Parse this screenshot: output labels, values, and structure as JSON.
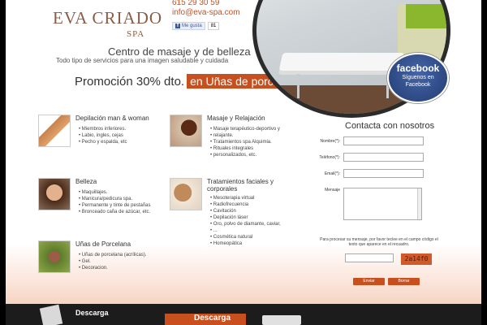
{
  "header": {
    "logo_main": "EVA CRIADO",
    "logo_sub": "SPA",
    "phone": "615 29 30 59",
    "email": "info@eva-spa.com",
    "like_label": "Me gusta",
    "like_count": "81"
  },
  "hero": {
    "headline": "Centro de masaje y de belleza",
    "tagline": "Todo tipo de servicios para una imagen saludable y cuidada",
    "promo_text": "Promoción 30% dto.",
    "promo_highlight": "en Uñas de porcelana"
  },
  "facebook_badge": {
    "title": "facebook",
    "line1": "Síguenos en",
    "line2": "Facebook"
  },
  "services": [
    {
      "title": "Depilación man & woman",
      "items": [
        "Miembros inferiores.",
        "Labio, ingles, cejas",
        "Pecho y espalda, etc"
      ]
    },
    {
      "title": "Masaje y Relajación",
      "items": [
        "Masaje terapéutico-deportivo y",
        "relajante.",
        "Tratamientos spa Alquimia.",
        "Rituales integrales",
        "personalizados, etc."
      ]
    },
    {
      "title": "Belleza",
      "items": [
        "Maquillajes.",
        "Manicura/pedicura spa.",
        "Permanente y tinte de pestañas",
        "Bronceado caña de azúcar, etc."
      ]
    },
    {
      "title": "Tratamientos faciales y",
      "title2": "corporales",
      "items": [
        "Mesoterapia virtual",
        "Radiofrecuencia",
        "Cavitación",
        "Depilación láser",
        "Oro, polvo de diamante, caviar,",
        "...",
        "Cosmética natural",
        "Homeopática"
      ]
    },
    {
      "title": "Uñas de Porcelana",
      "items": [
        "Uñas de porcelana (acrílicas).",
        "Gel.",
        "Decoracion."
      ]
    }
  ],
  "form": {
    "title": "Contacta con nosotros",
    "name_label": "Nombre(*):",
    "phone_label": "Teléfono(*):",
    "email_label": "Email(*):",
    "message_label": "Mensaje",
    "captcha_text": "Para procesar su mensaje, por favor teclee en el campo código el texto que aparece en el recuadro.",
    "captcha_code": "2a14f0",
    "submit_label": "Enviar",
    "reset_label": "Borrar"
  },
  "bottom": {
    "download_label": "Descarga",
    "download2_label": "Descarga"
  },
  "colors": {
    "accent": "#c8501e",
    "facebook": "#3b5998"
  }
}
